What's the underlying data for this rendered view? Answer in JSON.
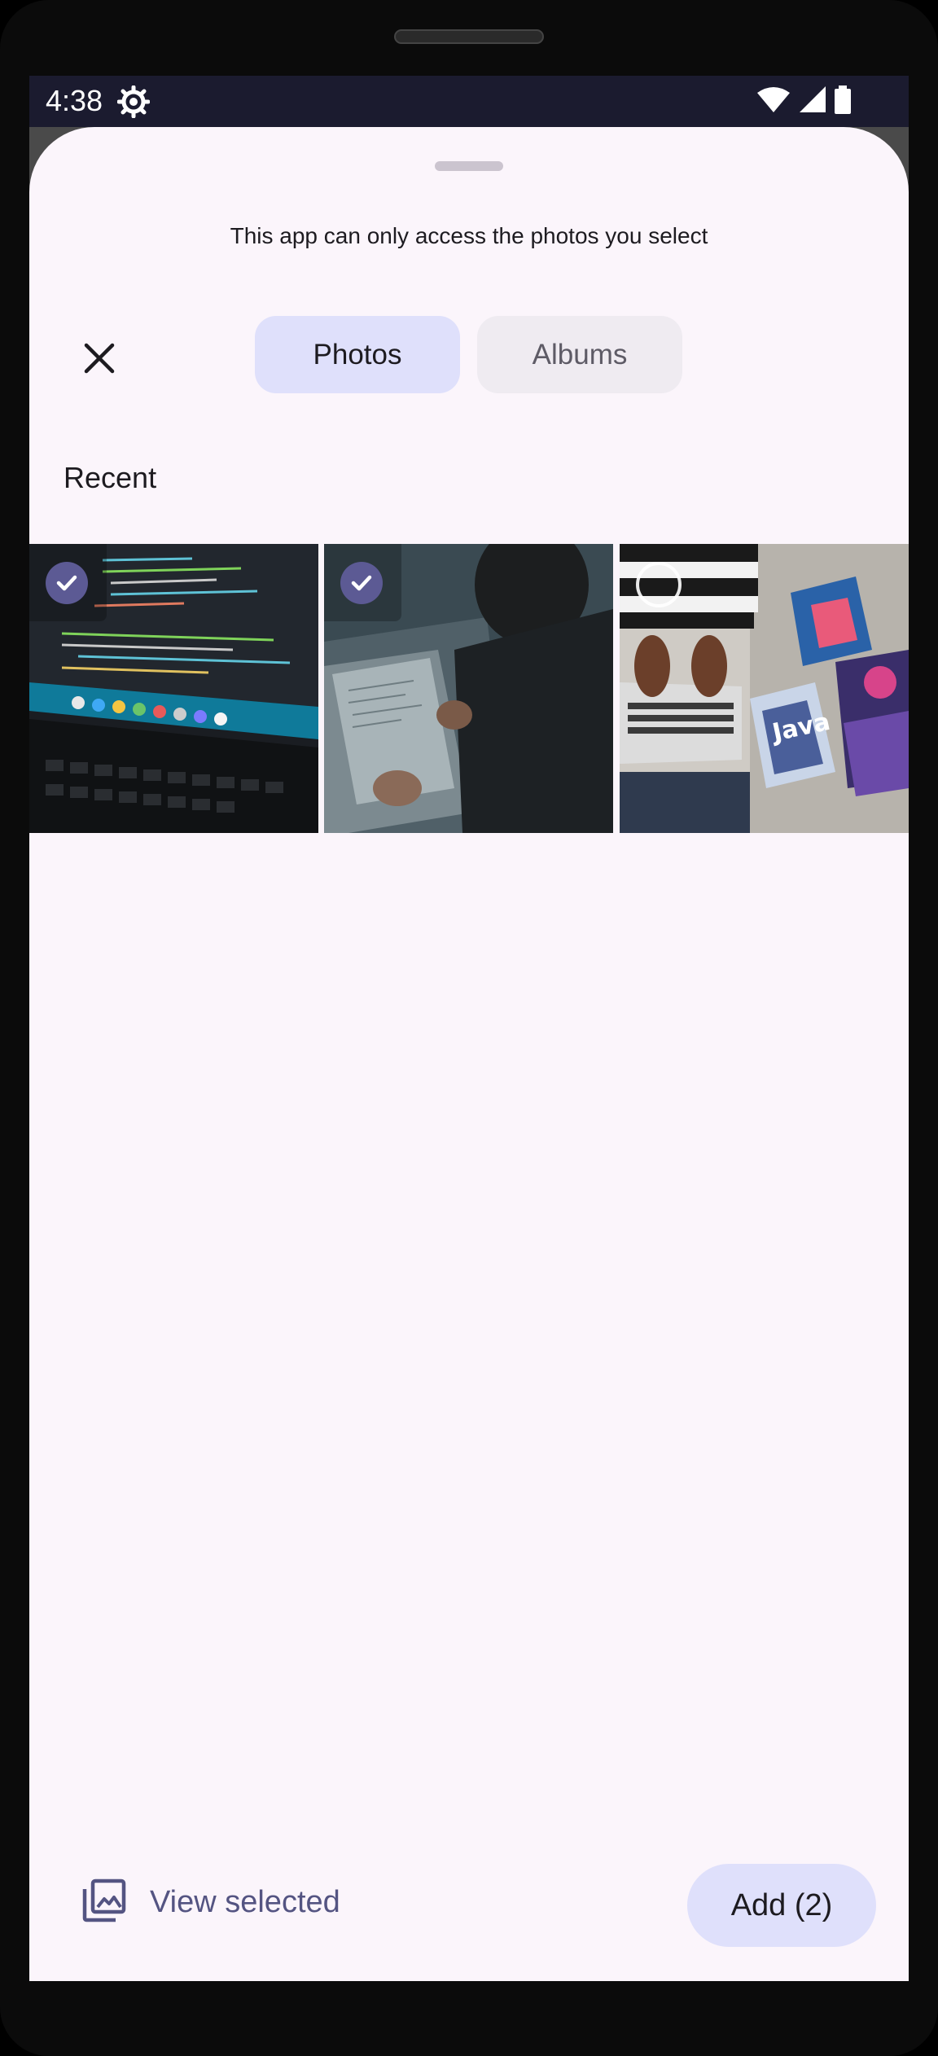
{
  "status_bar": {
    "time": "4:38",
    "icons": [
      "settings-gear-icon",
      "wifi-icon",
      "signal-icon",
      "battery-icon"
    ]
  },
  "picker": {
    "subtitle": "This app can only access the photos you select",
    "tabs": [
      {
        "label": "Photos",
        "active": true
      },
      {
        "label": "Albums",
        "active": false
      }
    ],
    "section_label": "Recent",
    "photos": [
      {
        "subject": "laptop-code-screen",
        "selected": true
      },
      {
        "subject": "person-typing-laptop",
        "selected": true
      },
      {
        "subject": "laptop-with-books",
        "selected": false
      }
    ]
  },
  "footer": {
    "view_selected_label": "View selected",
    "add_button_label": "Add (2)"
  },
  "colors": {
    "sheet_background": "#fbf5fb",
    "active_tab": "#dfe0fb",
    "inactive_tab": "#efebf1",
    "accent": "#5c5a94",
    "status_bar": "#1b1b2f"
  }
}
